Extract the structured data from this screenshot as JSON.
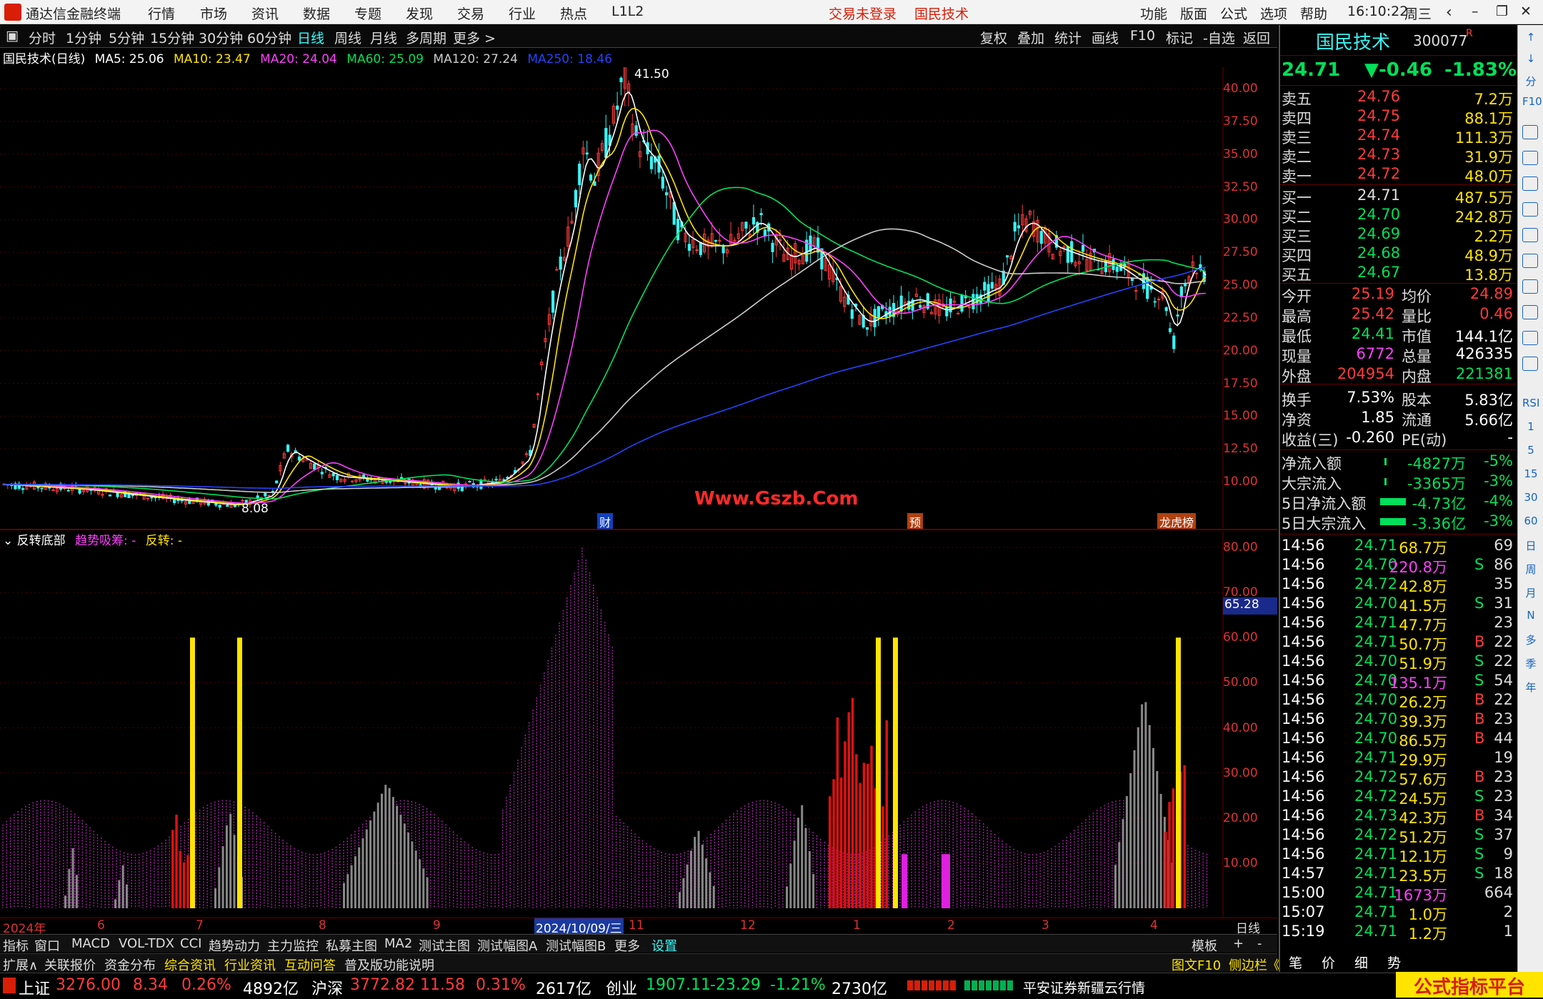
{
  "titlebar": {
    "app_title": "通达信金融终端",
    "menus": [
      "行情",
      "市场",
      "资讯",
      "数据",
      "专题",
      "发现",
      "交易",
      "行业",
      "热点",
      "L1L2"
    ],
    "trade_status": "交易未登录",
    "stock_name": "国民技术",
    "right_menus": [
      "功能",
      "版面",
      "公式",
      "选项",
      "帮助"
    ],
    "time": "16:10:22",
    "weekday": "周三"
  },
  "toolbar": {
    "periods": [
      "分时",
      "1分钟",
      "5分钟",
      "15分钟",
      "30分钟",
      "60分钟",
      "日线",
      "周线",
      "月线",
      "多周期",
      "更多 >"
    ],
    "active_period": "日线",
    "tools": [
      "复权",
      "叠加",
      "统计",
      "画线",
      "F10",
      "标记",
      "-自选",
      "返回"
    ]
  },
  "ma_legend": {
    "title": "国民技术(日线)",
    "items": [
      {
        "label": "MA5: 25.06",
        "color": "#ffffff"
      },
      {
        "label": "MA10: 23.47",
        "color": "#ffe400"
      },
      {
        "label": "MA20: 24.04",
        "color": "#ff40ff"
      },
      {
        "label": "MA60: 25.09",
        "color": "#00e05a"
      },
      {
        "label": "MA120: 27.24",
        "color": "#cccccc"
      },
      {
        "label": "MA250: 18.46",
        "color": "#2244ff"
      }
    ]
  },
  "main_axis": [
    "40.00",
    "37.50",
    "35.00",
    "32.50",
    "30.00",
    "27.50",
    "25.00",
    "22.50",
    "20.00",
    "17.50",
    "15.00",
    "12.50",
    "10.00"
  ],
  "main_annotations": {
    "high": "41.50",
    "low": "8.08",
    "watermark": "Www.Gszb.Com",
    "markers": [
      "财",
      "预",
      "龙虎榜"
    ]
  },
  "sub_legend": {
    "title": "反转底部",
    "l1": "趋势吸筹: -",
    "l2": "反转: -"
  },
  "sub_axis": [
    "80.00",
    "70.00",
    "60.00",
    "50.00",
    "40.00",
    "30.00",
    "20.00",
    "10.00"
  ],
  "sub_current": "65.28",
  "x_axis": [
    "2024年",
    "6",
    "7",
    "8",
    "9",
    "2024/10/09/三",
    "11",
    "12",
    "1",
    "2",
    "3",
    "4",
    "日线"
  ],
  "tabs1": [
    "指标",
    "窗口",
    "MACD",
    "VOL-TDX",
    "CCI",
    "趋势动力",
    "主力监控",
    "私募主图",
    "MA2",
    "测试主图",
    "测试幅图A",
    "测试幅图B",
    "更多",
    "设置"
  ],
  "tabs1_right": [
    "模板",
    "+",
    "-"
  ],
  "tabs2": [
    "扩展∧",
    "关联报价",
    "资金分布",
    "综合资讯",
    "行业资讯",
    "互动问答",
    "普及版功能说明"
  ],
  "tabs2_right": [
    "图文F10",
    "侧边栏《",
    "笔",
    "价",
    "细",
    "势"
  ],
  "status": {
    "sh_label": "上证",
    "sh_val": "3276.00",
    "sh_chg": "8.34",
    "sh_pct": "0.26%",
    "sh_amt": "4892亿",
    "hs_label": "沪深",
    "hs_val": "3772.82",
    "hs_chg": "11.58",
    "hs_pct": "0.31%",
    "hs_amt": "2617亿",
    "cy_label": "创业",
    "cy_val": "1907.11",
    "cy_chg": "-23.29",
    "cy_pct": "-1.21%",
    "cy_amt": "2730亿",
    "broker": "平安证券新疆云行情",
    "promo": "公式指标平台"
  },
  "quote": {
    "name": "国民技术",
    "code": "300077",
    "flag": "R",
    "price": "24.71",
    "change": "▼-0.46",
    "pct": "-1.83%",
    "asks": [
      [
        "卖五",
        "24.76",
        "7.2万"
      ],
      [
        "卖四",
        "24.75",
        "88.1万"
      ],
      [
        "卖三",
        "24.74",
        "111.3万"
      ],
      [
        "卖二",
        "24.73",
        "31.9万"
      ],
      [
        "卖一",
        "24.72",
        "48.0万"
      ]
    ],
    "bids": [
      [
        "买一",
        "24.71",
        "487.5万"
      ],
      [
        "买二",
        "24.70",
        "242.8万"
      ],
      [
        "买三",
        "24.69",
        "2.2万"
      ],
      [
        "买四",
        "24.68",
        "48.9万"
      ],
      [
        "买五",
        "24.67",
        "13.8万"
      ]
    ],
    "stats": [
      [
        "今开",
        "25.19",
        "均价",
        "24.89"
      ],
      [
        "最高",
        "25.42",
        "量比",
        "0.46"
      ],
      [
        "最低",
        "24.41",
        "市值",
        "144.1亿"
      ],
      [
        "现量",
        "6772",
        "总量",
        "426335"
      ],
      [
        "外盘",
        "204954",
        "内盘",
        "221381"
      ],
      [
        "换手",
        "7.53%",
        "股本",
        "5.83亿"
      ],
      [
        "净资",
        "1.85",
        "流通",
        "5.66亿"
      ],
      [
        "收益(三)",
        "-0.260",
        "PE(动)",
        "-"
      ]
    ],
    "flows": [
      [
        "净流入额",
        "-4827万",
        "-5%"
      ],
      [
        "大宗流入",
        "-3365万",
        "-3%"
      ],
      [
        "5日净流入额",
        "-4.73亿",
        "-4%"
      ],
      [
        "5日大宗流入",
        "-3.36亿",
        "-3%"
      ]
    ],
    "ticks": [
      [
        "14:56",
        "24.71",
        "68.7万",
        "",
        "69"
      ],
      [
        "14:56",
        "24.70",
        "220.8万",
        "S",
        "86"
      ],
      [
        "14:56",
        "24.72",
        "42.8万",
        "",
        "35"
      ],
      [
        "14:56",
        "24.70",
        "41.5万",
        "S",
        "31"
      ],
      [
        "14:56",
        "24.71",
        "47.7万",
        "",
        "23"
      ],
      [
        "14:56",
        "24.71",
        "50.7万",
        "B",
        "22"
      ],
      [
        "14:56",
        "24.70",
        "51.9万",
        "S",
        "22"
      ],
      [
        "14:56",
        "24.70",
        "135.1万",
        "S",
        "54"
      ],
      [
        "14:56",
        "24.70",
        "26.2万",
        "B",
        "22"
      ],
      [
        "14:56",
        "24.70",
        "39.3万",
        "B",
        "23"
      ],
      [
        "14:56",
        "24.70",
        "86.5万",
        "B",
        "44"
      ],
      [
        "14:56",
        "24.71",
        "29.9万",
        "",
        "19"
      ],
      [
        "14:56",
        "24.72",
        "57.6万",
        "B",
        "23"
      ],
      [
        "14:56",
        "24.72",
        "24.5万",
        "S",
        "23"
      ],
      [
        "14:56",
        "24.73",
        "42.3万",
        "B",
        "34"
      ],
      [
        "14:56",
        "24.72",
        "51.2万",
        "S",
        "37"
      ],
      [
        "14:56",
        "24.71",
        "12.1万",
        "S",
        "9"
      ],
      [
        "14:57",
        "24.71",
        "23.5万",
        "S",
        "18"
      ],
      [
        "15:00",
        "24.71",
        "1673万",
        "",
        "664"
      ],
      [
        "15:07",
        "24.71",
        "1.0万",
        "",
        "2"
      ],
      [
        "15:19",
        "24.71",
        "1.2万",
        "",
        "1"
      ]
    ]
  },
  "sidebar": [
    "↑",
    "↓",
    "分",
    "F10",
    "RSI",
    "1",
    "5",
    "15",
    "30",
    "60",
    "日",
    "周",
    "月",
    "N",
    "多",
    "季",
    "年"
  ]
}
